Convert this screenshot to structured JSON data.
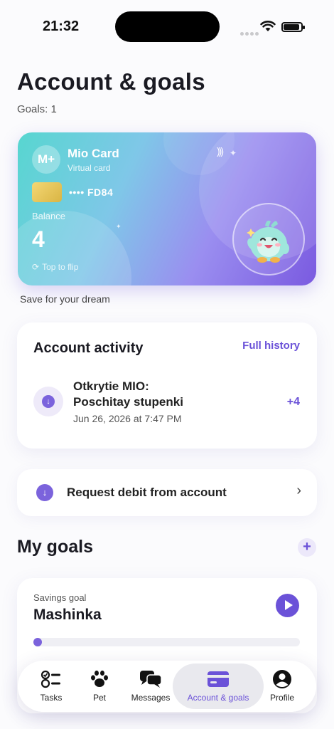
{
  "status_bar": {
    "time": "21:32"
  },
  "header": {
    "title": "Account & goals",
    "goals_count": "Goals: 1"
  },
  "card": {
    "logo": "M+",
    "name": "Mio Card",
    "subtitle": "Virtual card",
    "number": "•••• FD84",
    "balance_label": "Balance",
    "balance": "4",
    "flip_hint": "Top to flip",
    "caption": "Save for your dream"
  },
  "activity": {
    "title": "Account activity",
    "history_link": "Full history",
    "items": [
      {
        "line1": "Otkrytie MIO:",
        "line2": "Poschitay stupenki",
        "date": "Jun 26, 2026 at 7:47 PM",
        "amount": "+4",
        "icon": "arrow-down-icon"
      }
    ]
  },
  "request": {
    "label": "Request debit from account",
    "icon": "arrow-down-icon"
  },
  "goals": {
    "title": "My goals",
    "items": [
      {
        "type": "Savings goal",
        "name": "Mashinka",
        "progress": 0.0
      }
    ]
  },
  "tabbar": {
    "tabs": [
      {
        "label": "Tasks",
        "icon": "tasks-icon"
      },
      {
        "label": "Pet",
        "icon": "paw-icon"
      },
      {
        "label": "Messages",
        "icon": "messages-icon"
      },
      {
        "label": "Account & goals",
        "icon": "card-icon",
        "active": true
      },
      {
        "label": "Profile",
        "icon": "profile-icon"
      }
    ]
  },
  "colors": {
    "accent": "#6b52d8",
    "card_start": "#57d6d0",
    "card_end": "#7a5ae0"
  }
}
